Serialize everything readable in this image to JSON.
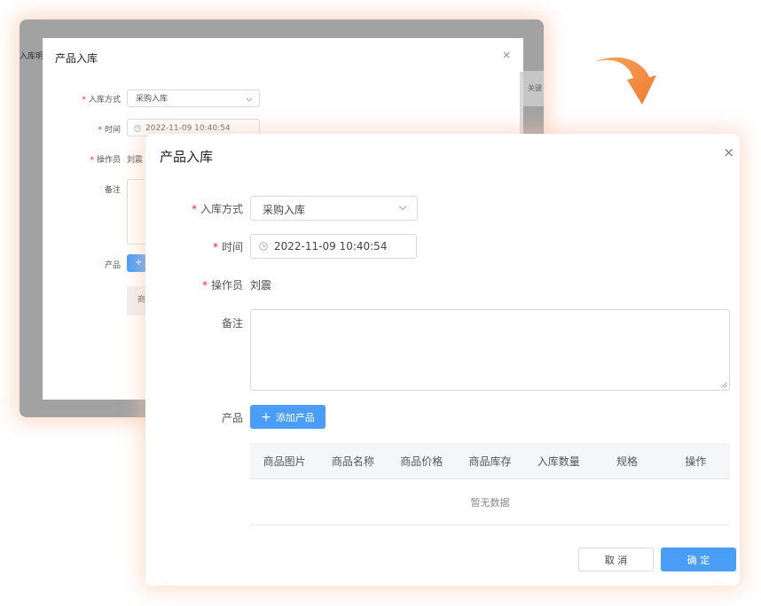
{
  "back_window": {
    "app_tab": "入库明细",
    "right_label": "关键",
    "dialog": {
      "title": "产品入库",
      "close": "×",
      "fields": {
        "method_label": "入库方式",
        "method_value": "采购入库",
        "time_label": "时间",
        "time_value": "2022-11-09 10:40:54",
        "operator_label": "操作员",
        "operator_value": "刘震",
        "remark_label": "备注",
        "product_label": "产品",
        "add_button": "+",
        "table_first_col": "商"
      }
    }
  },
  "dialog": {
    "title": "产品入库",
    "close": "×",
    "fields": {
      "method_label": "入库方式",
      "method_value": "采购入库",
      "time_label": "时间",
      "time_value": "2022-11-09 10:40:54",
      "operator_label": "操作员",
      "operator_value": "刘震",
      "remark_label": "备注",
      "remark_value": "",
      "product_label": "产品"
    },
    "add_product_button": "添加产品",
    "add_product_icon": "+",
    "table": {
      "columns": [
        "商品图片",
        "商品名称",
        "商品价格",
        "商品库存",
        "入库数量",
        "规格",
        "操作"
      ],
      "empty_text": "暂无数据"
    },
    "buttons": {
      "cancel": "取 消",
      "confirm": "确 定"
    }
  },
  "colors": {
    "primary": "#4a9ef8",
    "required": "#f5222d",
    "arrow": "#f0833f",
    "shadow": "#f8c8af"
  },
  "icons": {
    "select": "chevron-down-icon",
    "time": "clock-icon",
    "close": "close-icon",
    "arrow": "curved-arrow-icon"
  }
}
